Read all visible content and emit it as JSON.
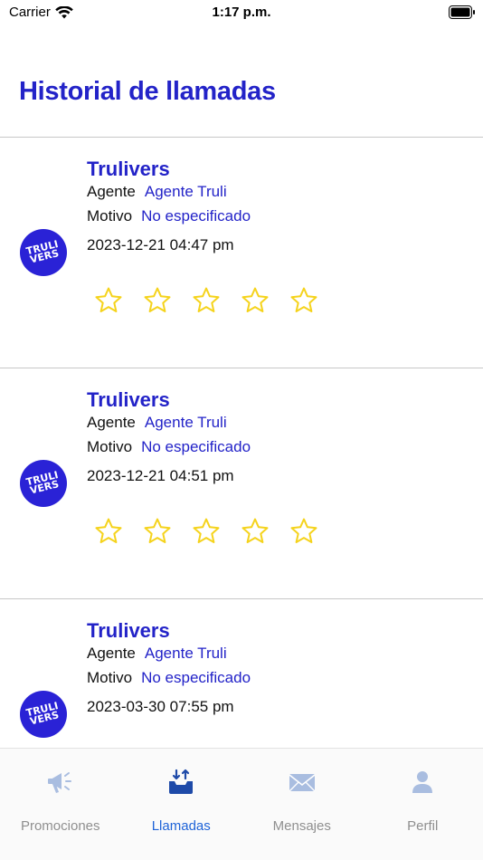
{
  "status_bar": {
    "carrier": "Carrier",
    "time": "1:17 p.m."
  },
  "header": {
    "title": "Historial de llamadas"
  },
  "calls": [
    {
      "logo": "TRULI VERS",
      "company": "Trulivers",
      "agent_label": "Agente",
      "agent": "Agente Truli",
      "reason_label": "Motivo",
      "reason": "No especificado",
      "datetime": "2023-12-21 04:47 pm",
      "rating": 0,
      "rating_max": 5
    },
    {
      "logo": "TRULI VERS",
      "company": "Trulivers",
      "agent_label": "Agente",
      "agent": "Agente Truli",
      "reason_label": "Motivo",
      "reason": "No especificado",
      "datetime": "2023-12-21 04:51 pm",
      "rating": 0,
      "rating_max": 5
    },
    {
      "logo": "TRULI VERS",
      "company": "Trulivers",
      "agent_label": "Agente",
      "agent": "Agente Truli",
      "reason_label": "Motivo",
      "reason": "No especificado",
      "datetime": "2023-03-30 07:55 pm",
      "rating": 0,
      "rating_max": 5
    }
  ],
  "tab_bar": {
    "tabs": [
      {
        "label": "Promociones",
        "icon": "megaphone-icon",
        "active": false
      },
      {
        "label": "Llamadas",
        "icon": "inbox-download-icon",
        "active": true
      },
      {
        "label": "Mensajes",
        "icon": "envelope-icon",
        "active": false
      },
      {
        "label": "Perfil",
        "icon": "person-icon",
        "active": false
      }
    ]
  },
  "colors": {
    "accent": "#2323c8",
    "logo_bg": "#2a22d6",
    "star": "#f5d31c",
    "tab_active": "#1e63d8",
    "tab_inactive": "#8f8f8f",
    "tab_icon_inactive": "#a9bde0"
  }
}
